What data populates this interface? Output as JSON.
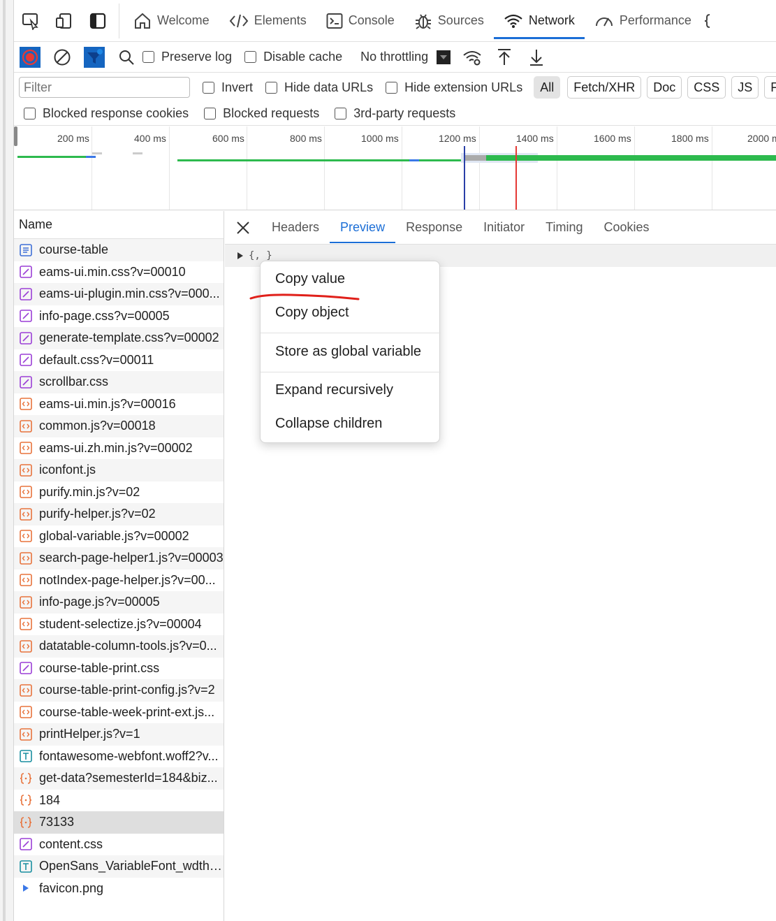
{
  "tabs": [
    {
      "label": "Welcome",
      "icon": "home-icon"
    },
    {
      "label": "Elements",
      "icon": "code-icon"
    },
    {
      "label": "Console",
      "icon": "console-icon"
    },
    {
      "label": "Sources",
      "icon": "bug-icon"
    },
    {
      "label": "Network",
      "icon": "wifi-icon",
      "active": true
    },
    {
      "label": "Performance",
      "icon": "gauge-icon"
    }
  ],
  "toolbar": {
    "preserve_log": "Preserve log",
    "disable_cache": "Disable cache",
    "throttling": "No throttling"
  },
  "filter": {
    "placeholder": "Filter",
    "invert": "Invert",
    "hide_data_urls": "Hide data URLs",
    "hide_extension_urls": "Hide extension URLs",
    "types": [
      "All",
      "Fetch/XHR",
      "Doc",
      "CSS",
      "JS",
      "Fon"
    ],
    "blocked_response_cookies": "Blocked response cookies",
    "blocked_requests": "Blocked requests",
    "third_party_requests": "3rd-party requests"
  },
  "timeline": {
    "labels": [
      "200 ms",
      "400 ms",
      "600 ms",
      "800 ms",
      "1000 ms",
      "1200 ms",
      "1400 ms",
      "1600 ms",
      "1800 ms",
      "2000 m"
    ]
  },
  "requests": {
    "header": "Name",
    "items": [
      {
        "name": "course-table",
        "type": "doc"
      },
      {
        "name": "eams-ui.min.css?v=00010",
        "type": "css"
      },
      {
        "name": "eams-ui-plugin.min.css?v=000...",
        "type": "css"
      },
      {
        "name": "info-page.css?v=00005",
        "type": "css"
      },
      {
        "name": "generate-template.css?v=00002",
        "type": "css"
      },
      {
        "name": "default.css?v=00011",
        "type": "css"
      },
      {
        "name": "scrollbar.css",
        "type": "css"
      },
      {
        "name": "eams-ui.min.js?v=00016",
        "type": "js"
      },
      {
        "name": "common.js?v=00018",
        "type": "js"
      },
      {
        "name": "eams-ui.zh.min.js?v=00002",
        "type": "js"
      },
      {
        "name": "iconfont.js",
        "type": "js"
      },
      {
        "name": "purify.min.js?v=02",
        "type": "js"
      },
      {
        "name": "purify-helper.js?v=02",
        "type": "js"
      },
      {
        "name": "global-variable.js?v=00002",
        "type": "js"
      },
      {
        "name": "search-page-helper1.js?v=00003",
        "type": "js"
      },
      {
        "name": "notIndex-page-helper.js?v=00...",
        "type": "js"
      },
      {
        "name": "info-page.js?v=00005",
        "type": "js"
      },
      {
        "name": "student-selectize.js?v=00004",
        "type": "js"
      },
      {
        "name": "datatable-column-tools.js?v=0...",
        "type": "js"
      },
      {
        "name": "course-table-print.css",
        "type": "css"
      },
      {
        "name": "course-table-print-config.js?v=2",
        "type": "js"
      },
      {
        "name": "course-table-week-print-ext.js...",
        "type": "js"
      },
      {
        "name": "printHelper.js?v=1",
        "type": "js"
      },
      {
        "name": "fontawesome-webfont.woff2?v...",
        "type": "font"
      },
      {
        "name": "get-data?semesterId=184&biz...",
        "type": "xhr"
      },
      {
        "name": "184",
        "type": "xhr"
      },
      {
        "name": "73133",
        "type": "xhr",
        "selected": true
      },
      {
        "name": "content.css",
        "type": "css"
      },
      {
        "name": "OpenSans_VariableFont_wdth_...",
        "type": "font"
      },
      {
        "name": "favicon.png",
        "type": "img"
      }
    ]
  },
  "detail": {
    "tabs": [
      "Headers",
      "Preview",
      "Response",
      "Initiator",
      "Timing",
      "Cookies"
    ],
    "active_tab": "Preview",
    "preview_text": "{, }"
  },
  "context_menu": {
    "items": [
      "Copy value",
      "Copy object",
      "Store as global variable",
      "Expand recursively",
      "Collapse children"
    ]
  },
  "colors": {
    "accent": "#1b6ed6",
    "css_icon": "#9b3fd6",
    "js_icon": "#e8733c",
    "doc_icon": "#3f6fd6",
    "font_icon": "#1a8fa0",
    "annotation": "#e0201a",
    "waterfall_green": "#2dba4e"
  }
}
